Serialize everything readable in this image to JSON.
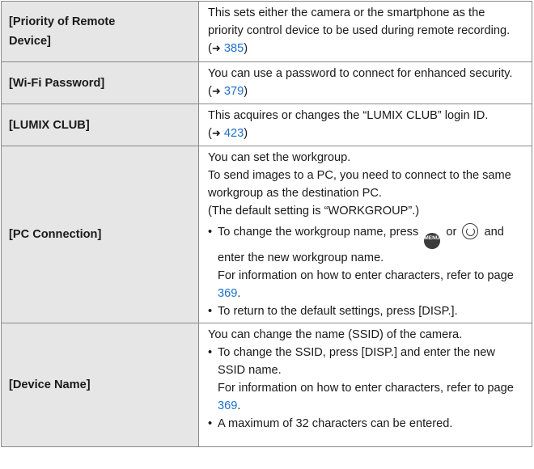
{
  "rows": [
    {
      "name": "[Priority of Remote Device]",
      "name_lines": [
        "[Priority of Remote",
        "Device]"
      ],
      "desc_before": "This sets either the camera or the smartphone as the priority control device to be used during remote recording. (",
      "arrow": "➜",
      "page": "385",
      "desc_after": ")"
    },
    {
      "name": "[Wi-Fi Password]",
      "desc_before": "You can use a password to connect for enhanced security. (",
      "arrow": "➜",
      "page": "379",
      "desc_after": ")"
    },
    {
      "name": "[LUMIX CLUB]",
      "desc_before": "This acquires or changes the “LUMIX CLUB” login ID. (",
      "arrow": "➜",
      "page": "423",
      "desc_after": ")"
    },
    {
      "name": "[PC Connection]",
      "lines": [
        "You can set the workgroup.",
        "To send images to a PC, you need to connect to the same workgroup as the destination PC.",
        "(The default setting is “WORKGROUP”.)"
      ],
      "bullet1_before": "To change the workgroup name, press",
      "bullet1_or": "or",
      "bullet1_after": "and enter the new workgroup name.",
      "bullet1_note": "For information on how to enter characters, refer to page",
      "bullet1_page": "369",
      "bullet1_end": ".",
      "bullet2": "To return to the default settings, press [DISP.].",
      "menu_icon_text": "MENU/SET",
      "icons": [
        "menu-set-button-icon",
        "control-dial-icon"
      ]
    },
    {
      "name": "[Device Name]",
      "lines": [
        "You can change the name (SSID) of the camera."
      ],
      "bullet1": "To change the SSID, press [DISP.] and enter the new SSID name.",
      "bullet1_note": "For information on how to enter characters, refer to page",
      "bullet1_page": "369",
      "bullet1_end": ".",
      "bullet2": "A maximum of 32 characters can be entered."
    }
  ],
  "colors": {
    "name_bg": "#e6e6e6",
    "border": "#8a8a8a",
    "link": "#1b6fc9"
  }
}
